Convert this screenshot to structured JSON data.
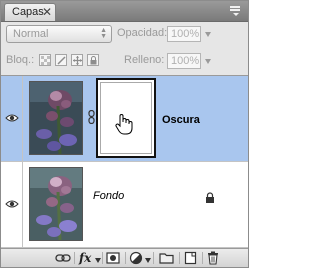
{
  "panel": {
    "tab_label": "Capas",
    "close_glyph": "✕",
    "blend_mode": "Normal",
    "opacity_label": "Opacidad:",
    "opacity_value": "100%",
    "lock_label": "Bloq.:",
    "fill_label": "Relleno:",
    "fill_value": "100%"
  },
  "layers": [
    {
      "name": "Oscura",
      "visible": true,
      "selected": true,
      "has_mask": true,
      "locked": false
    },
    {
      "name": "Fondo",
      "visible": true,
      "selected": false,
      "has_mask": false,
      "locked": true
    }
  ],
  "toolbar": {
    "fx_label": "fx",
    "icons": [
      "link-layers-icon",
      "layer-style-icon",
      "add-mask-icon",
      "adjustment-layer-icon",
      "new-group-icon",
      "new-layer-icon",
      "delete-icon"
    ]
  },
  "colors": {
    "selection": "#a9c6ee",
    "panel_bg": "#e6e6e6"
  }
}
